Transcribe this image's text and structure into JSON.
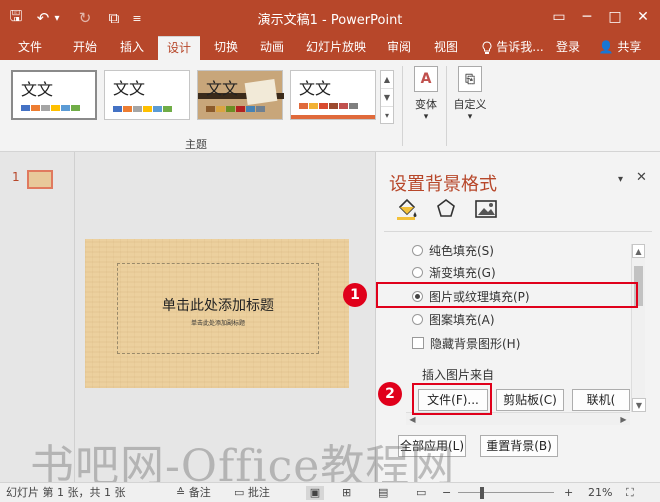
{
  "window": {
    "title": "演示文稿1 - PowerPoint",
    "quick_access": {
      "save": "🖫",
      "undo": "↶",
      "undo_dropdown": "▾",
      "redo": "↻",
      "present": "⧉",
      "customize": "≡"
    },
    "controls": {
      "restore": "▭",
      "minimize": "─",
      "maximize": "□",
      "close": "✕"
    }
  },
  "ribbon_tabs": [
    "文件",
    "开始",
    "插入",
    "设计",
    "切换",
    "动画",
    "幻灯片放映",
    "审阅",
    "视图"
  ],
  "active_tab": "设计",
  "tell_me": "告诉我...",
  "tell_me_icon": "bulb-icon",
  "login": "登录",
  "share": "共享",
  "themes": {
    "items": [
      {
        "label": "文文",
        "selected": true,
        "bg": "#ffffff",
        "colors": [
          "#4472c4",
          "#ed7d31",
          "#a5a5a5",
          "#ffc000",
          "#5b9bd5",
          "#70ad47"
        ]
      },
      {
        "label": "文文",
        "selected": false,
        "bg": "#ffffff",
        "colors": [
          "#4472c4",
          "#ed7d31",
          "#a5a5a5",
          "#ffc000",
          "#5b9bd5",
          "#70ad47"
        ]
      },
      {
        "label": "文文",
        "selected": false,
        "bg": "#c8a67a",
        "colors": [
          "#8b5a2b",
          "#d9a441",
          "#6b8e23",
          "#b22222",
          "#4682b4",
          "#708090"
        ]
      },
      {
        "label": "文文",
        "selected": false,
        "bg": "#ffffff",
        "colors": [
          "#e06a3b",
          "#f2b134",
          "#d84a2e",
          "#9c4a2e",
          "#c0504d",
          "#7f7f7f"
        ]
      }
    ],
    "group_label": "主题"
  },
  "variants": {
    "label": "变体",
    "arrow": "▾"
  },
  "customize": {
    "label": "自定义",
    "arrow": "▾"
  },
  "thumbnails": {
    "number": "1"
  },
  "slide": {
    "title": "单击此处添加标题",
    "subtitle": "单击此处添加副标题"
  },
  "format_pane": {
    "title": "设置背景格式",
    "pin_icon": "▾",
    "close_icon": "✕",
    "options": [
      {
        "label": "纯色填充(S)",
        "type": "radio",
        "checked": false
      },
      {
        "label": "渐变填充(G)",
        "type": "radio",
        "checked": false
      },
      {
        "label": "图片或纹理填充(P)",
        "type": "radio",
        "checked": true
      },
      {
        "label": "图案填充(A)",
        "type": "radio",
        "checked": false
      },
      {
        "label": "隐藏背景图形(H)",
        "type": "checkbox",
        "checked": false
      }
    ],
    "insert_from": "插入图片来自",
    "file_button": "文件(F)...",
    "clipboard_button": "剪贴板(C)",
    "online_button": "联机(",
    "apply_all": "全部应用(L)",
    "reset": "重置背景(B)"
  },
  "markers": [
    "1",
    "2"
  ],
  "status": {
    "slide_info": "幻灯片 第 1 张，共 1 张",
    "notes": "备注",
    "comments": "批注",
    "zoom_minus": "−",
    "zoom_plus": "+",
    "zoom": "21%"
  },
  "watermark": "书吧网-Office教程网",
  "colors": {
    "accent": "#b7472a",
    "highlight": "#e0001b"
  }
}
